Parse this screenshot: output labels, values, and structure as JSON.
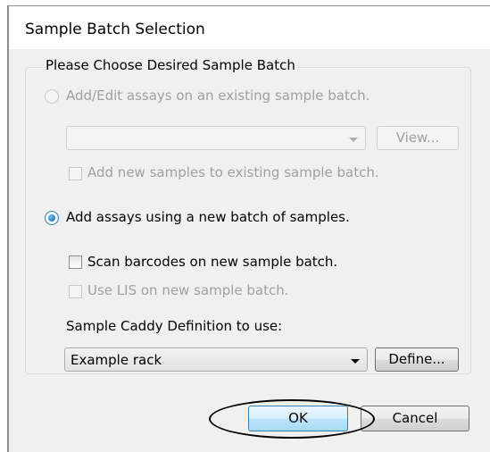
{
  "window": {
    "title": "Sample Batch Selection"
  },
  "group": {
    "legend": "Please Choose Desired Sample Batch"
  },
  "existing": {
    "radio_label": "Add/Edit assays on an existing sample batch.",
    "batch_value": "",
    "view_label": "View...",
    "add_samples_label": "Add new samples to existing sample batch."
  },
  "new_batch": {
    "radio_label": "Add assays using a new batch of samples.",
    "scan_label": "Scan barcodes on new sample batch.",
    "lis_label": "Use LIS on new sample batch."
  },
  "caddy": {
    "label": "Sample Caddy Definition to use:",
    "value": "Example rack",
    "define_label": "Define..."
  },
  "footer": {
    "ok_label": "OK",
    "cancel_label": "Cancel"
  }
}
